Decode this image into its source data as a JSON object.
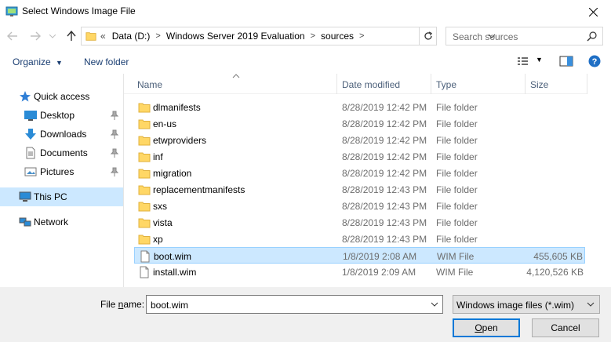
{
  "window": {
    "title": "Select Windows Image File"
  },
  "address": {
    "overflow": "«",
    "crumbs": [
      "Data (D:)",
      "Windows Server 2019 Evaluation",
      "sources"
    ]
  },
  "search": {
    "placeholder": "Search sources"
  },
  "toolbar": {
    "organize": "Organize",
    "new_folder": "New folder"
  },
  "nav": {
    "quick_access": "Quick access",
    "items": [
      "Desktop",
      "Downloads",
      "Documents",
      "Pictures"
    ],
    "this_pc": "This PC",
    "network": "Network"
  },
  "columns": {
    "name": "Name",
    "date": "Date modified",
    "type": "Type",
    "size": "Size"
  },
  "files": [
    {
      "name": "dlmanifests",
      "date": "8/28/2019 12:42 PM",
      "type": "File folder",
      "size": ""
    },
    {
      "name": "en-us",
      "date": "8/28/2019 12:42 PM",
      "type": "File folder",
      "size": ""
    },
    {
      "name": "etwproviders",
      "date": "8/28/2019 12:42 PM",
      "type": "File folder",
      "size": ""
    },
    {
      "name": "inf",
      "date": "8/28/2019 12:42 PM",
      "type": "File folder",
      "size": ""
    },
    {
      "name": "migration",
      "date": "8/28/2019 12:42 PM",
      "type": "File folder",
      "size": ""
    },
    {
      "name": "replacementmanifests",
      "date": "8/28/2019 12:43 PM",
      "type": "File folder",
      "size": ""
    },
    {
      "name": "sxs",
      "date": "8/28/2019 12:43 PM",
      "type": "File folder",
      "size": ""
    },
    {
      "name": "vista",
      "date": "8/28/2019 12:43 PM",
      "type": "File folder",
      "size": ""
    },
    {
      "name": "xp",
      "date": "8/28/2019 12:43 PM",
      "type": "File folder",
      "size": ""
    },
    {
      "name": "boot.wim",
      "date": "1/8/2019 2:08 AM",
      "type": "WIM File",
      "size": "455,605 KB"
    },
    {
      "name": "install.wim",
      "date": "1/8/2019 2:09 AM",
      "type": "WIM File",
      "size": "4,120,526 KB"
    }
  ],
  "bottom": {
    "filename_label_pre": "File ",
    "filename_label_u": "n",
    "filename_label_post": "ame:",
    "filename_value": "boot.wim",
    "filter_value": "Windows image files (*.wim)",
    "open_u": "O",
    "open_rest": "pen",
    "cancel": "Cancel"
  },
  "colors": {
    "selection": "#cce8ff",
    "selection_border": "#99d1ff",
    "folder": "#ffd766",
    "link": "#1a3e72"
  }
}
